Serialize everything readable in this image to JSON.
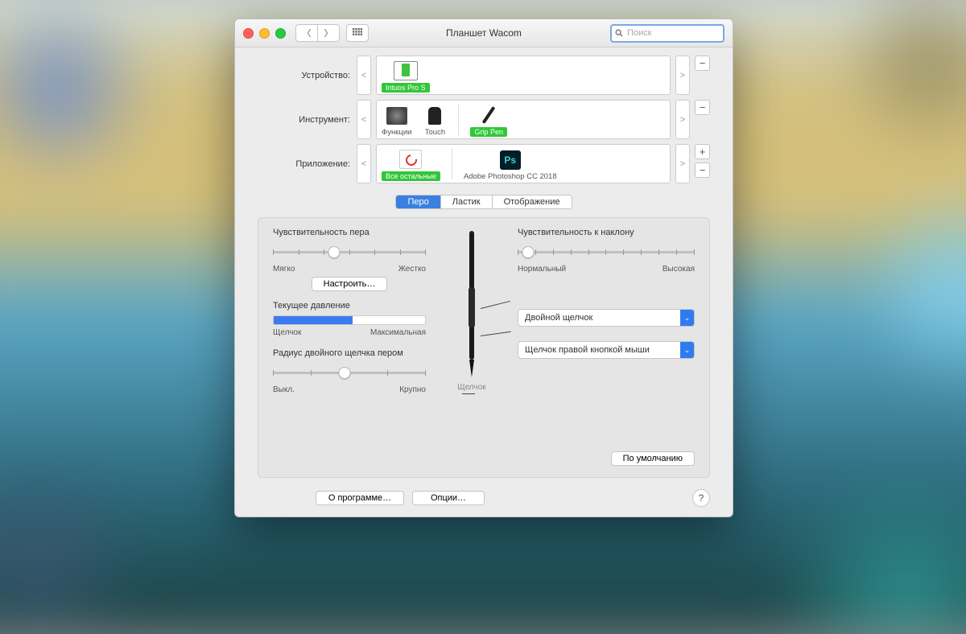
{
  "window": {
    "title": "Планшет Wacom"
  },
  "search": {
    "placeholder": "Поиск"
  },
  "pickers": {
    "device": {
      "label": "Устройство:",
      "item": "Intuos Pro S"
    },
    "tool": {
      "label": "Инструмент:",
      "items": [
        "Функции",
        "Touch",
        "Grip Pen"
      ]
    },
    "app": {
      "label": "Приложение:",
      "items": [
        "Все остальные",
        "Adobe Photoshop CC 2018"
      ],
      "ps_text": "Ps"
    }
  },
  "tabs": [
    "Перо",
    "Ластик",
    "Отображение"
  ],
  "pen": {
    "pressure_heading": "Чувствительность пера",
    "pressure_ends": [
      "Мягко",
      "Жестко"
    ],
    "customize": "Настроить…",
    "current_heading": "Текущее давление",
    "current_pct": 52,
    "current_ends": [
      "Щелчок",
      "Максимальная"
    ],
    "radius_heading": "Радиус двойного щелчка пером",
    "radius_ends": [
      "Выкл.",
      "Крупно"
    ],
    "tilt_heading": "Чувствительность к наклону",
    "tilt_ends": [
      "Нормальный",
      "Высокая"
    ],
    "dropdown1": "Двойной щелчок",
    "dropdown2": "Щелчок правой кнопкой мыши",
    "pen_label": "Щелчок",
    "default_btn": "По умолчанию"
  },
  "bottom": {
    "about": "О программе…",
    "options": "Опции…"
  }
}
